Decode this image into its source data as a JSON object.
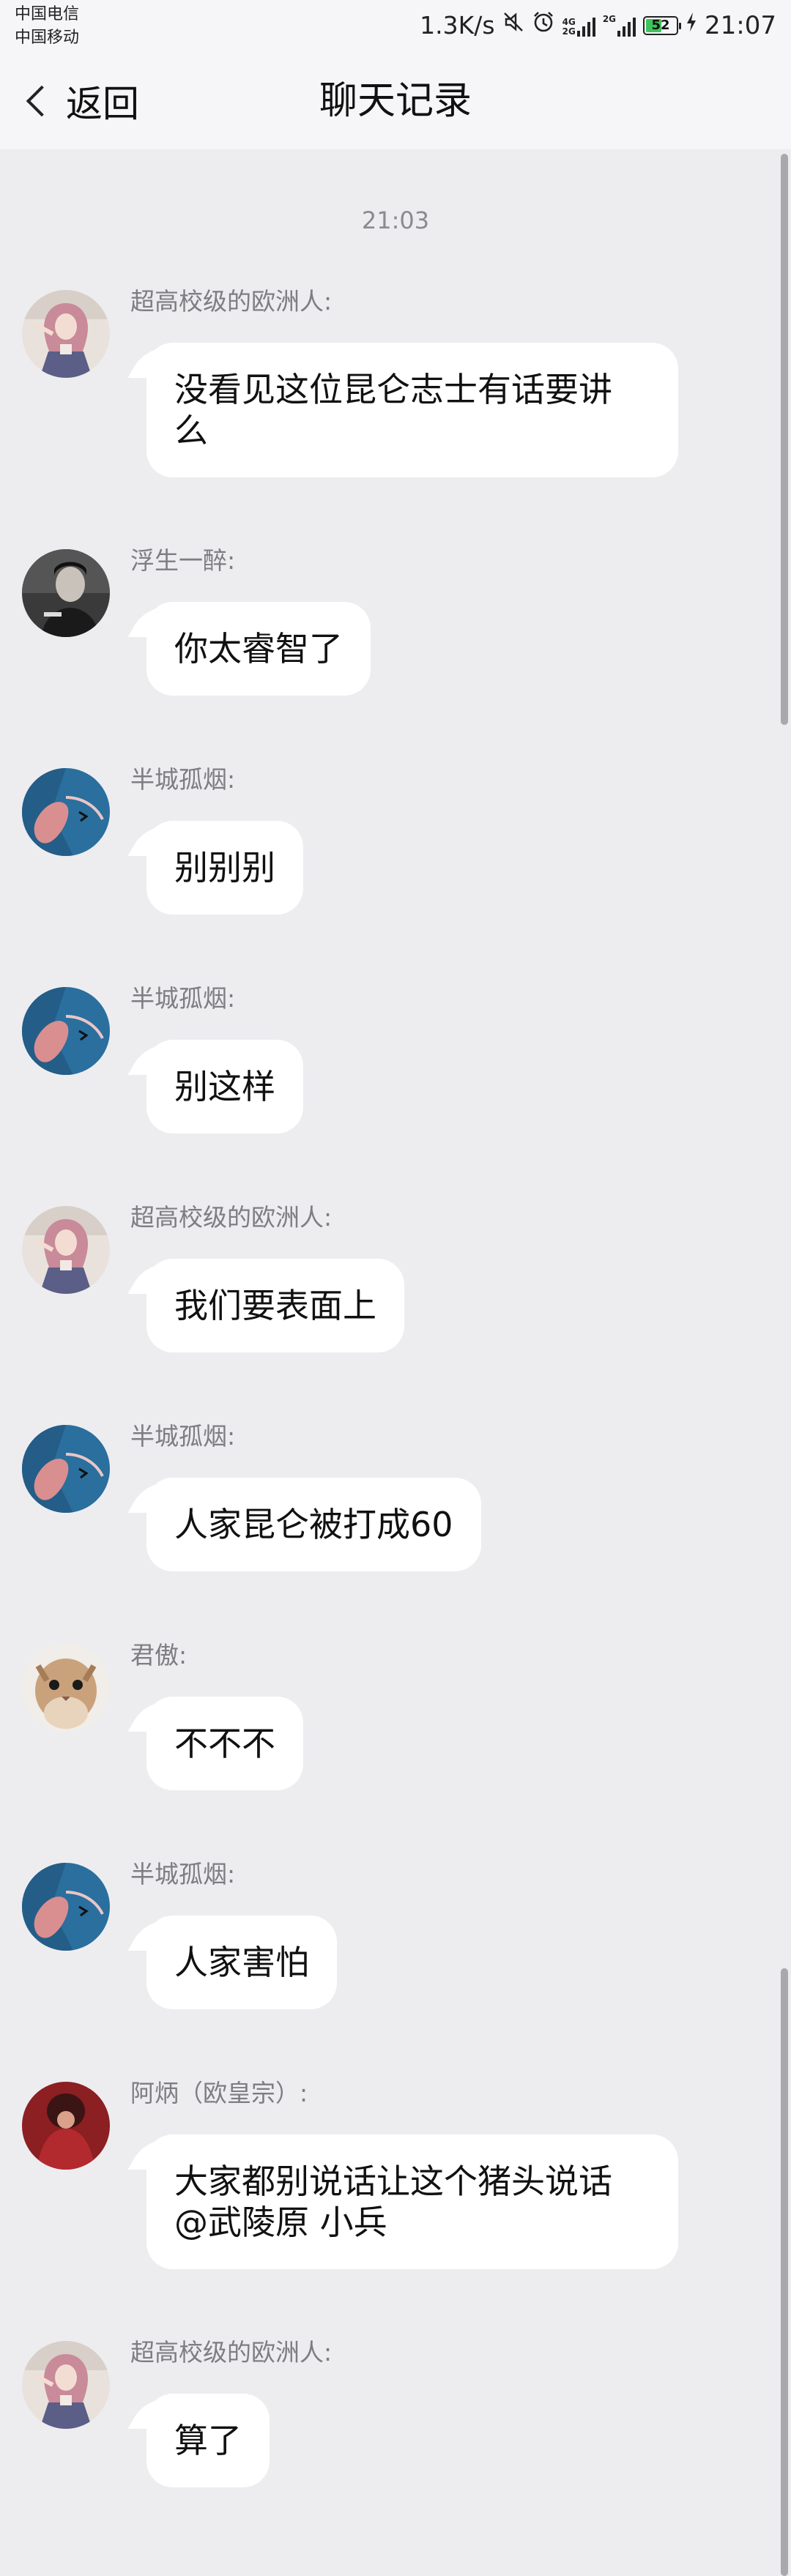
{
  "status_bar": {
    "carrier_1": "中国电信",
    "carrier_2": "中国移动",
    "network_speed": "1.3K/s",
    "net_tag_1": "4G",
    "net_tag_2": "2G",
    "net_tag_3": "2G",
    "battery_level": "52",
    "battery_percent": 52,
    "time": "21:07"
  },
  "nav": {
    "back_label": "返回",
    "title": "聊天记录"
  },
  "chat": {
    "timestamp": "21:03",
    "messages": [
      {
        "sender": "超高校级的欧洲人:",
        "text": "没看见这位昆仑志士有话要讲么",
        "avatar": "anime-avatar"
      },
      {
        "sender": "浮生一醉:",
        "text": "你太睿智了",
        "avatar": "person-avatar"
      },
      {
        "sender": "半城孤烟:",
        "text": "别别别",
        "avatar": "blue-art-avatar"
      },
      {
        "sender": "半城孤烟:",
        "text": "别这样",
        "avatar": "blue-art-avatar"
      },
      {
        "sender": "超高校级的欧洲人:",
        "text": "我们要表面上",
        "avatar": "anime-avatar"
      },
      {
        "sender": "半城孤烟:",
        "text": "人家昆仑被打成60",
        "avatar": "blue-art-avatar"
      },
      {
        "sender": "君傲:",
        "text": "不不不",
        "avatar": "cat-avatar"
      },
      {
        "sender": "半城孤烟:",
        "text": "人家害怕",
        "avatar": "blue-art-avatar"
      },
      {
        "sender": "阿炳（欧皇宗）:",
        "text": "大家都别说话让这个猪头说话@武陵原  小兵",
        "avatar": "red-avatar"
      },
      {
        "sender": "超高校级的欧洲人:",
        "text": "算了",
        "avatar": "anime-avatar"
      }
    ]
  },
  "colors": {
    "background": "#ededf0",
    "bubble": "#ffffff",
    "sender_text": "#7d7d82",
    "battery_fill": "#3ec35a"
  }
}
